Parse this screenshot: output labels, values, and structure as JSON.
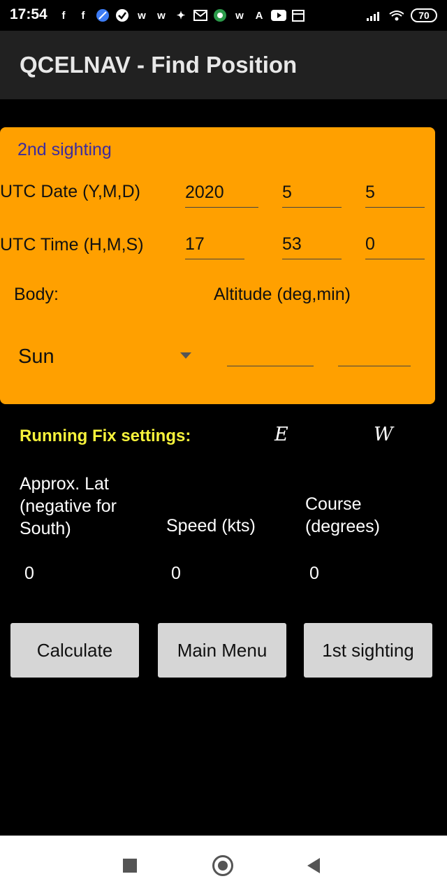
{
  "status_bar": {
    "time": "17:54",
    "notification_icons": [
      "facebook-icon",
      "facebook-icon",
      "browser-icon",
      "check-icon",
      "w-icon",
      "w-icon",
      "pin-icon",
      "gmail-icon",
      "circle-app-icon",
      "w-icon",
      "translate-icon",
      "youtube-icon",
      "calendar-icon"
    ],
    "battery": "70"
  },
  "app_bar": {
    "title": "QCELNAV - Find Position"
  },
  "sighting": {
    "title": "2nd sighting",
    "date_label": "UTC Date (Y,M,D)",
    "date": {
      "year": "2020",
      "month": "5",
      "day": "5"
    },
    "time_label": "UTC Time (H,M,S)",
    "time": {
      "hour": "17",
      "minute": "53",
      "second": "0"
    },
    "body_label": "Body:",
    "altitude_label": "Altitude (deg,min)",
    "body_selected": "Sun",
    "altitude": {
      "deg": "",
      "min": ""
    }
  },
  "running_fix": {
    "title": "Running Fix settings:",
    "east": "E",
    "west": "W",
    "lat_label": "Approx. Lat\n(negative for\nSouth)",
    "speed_label": "Speed (kts)",
    "course_label": "Course\n(degrees)",
    "lat_value": "0",
    "speed_value": "0",
    "course_value": "0"
  },
  "buttons": {
    "calculate": "Calculate",
    "main_menu": "Main Menu",
    "first_sighting": "1st sighting"
  },
  "colors": {
    "panel": "#ffa000",
    "running_fix_title": "#f7f33b",
    "sighting_title": "#3d2c9e"
  }
}
